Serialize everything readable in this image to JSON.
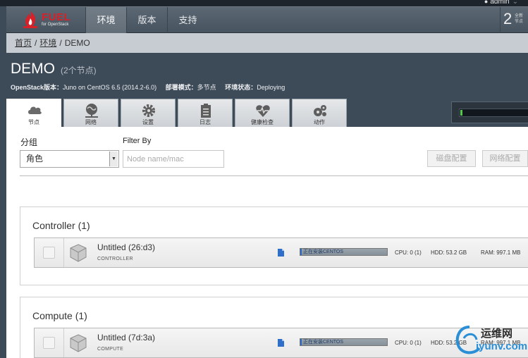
{
  "user": {
    "name": "admin"
  },
  "nav": {
    "logo_word": "FUEL",
    "logo_sub": "for OpenStack",
    "tabs": [
      {
        "label": "环境",
        "active": true
      },
      {
        "label": "版本",
        "active": false
      },
      {
        "label": "支持",
        "active": false
      }
    ],
    "notifications": {
      "count": "2",
      "label_line1": "全新",
      "label_line2": "节点"
    }
  },
  "breadcrumb": {
    "home": "首页",
    "environments": "环境",
    "current": "DEMO",
    "sep": "/"
  },
  "environment": {
    "name": "DEMO",
    "node_count_text": "(2个节点)",
    "openstack_label": "OpenStack版本：",
    "openstack_value": "Juno on CentOS 6.5 (2014.2-6.0)",
    "mode_label": "部署模式：",
    "mode_value": "多节点",
    "status_label": "环境状态：",
    "status_value": "Deploying",
    "deploy_progress": 0.02
  },
  "tabs": [
    {
      "label": "节点",
      "icon": "cloud-icon",
      "active": true
    },
    {
      "label": "网络",
      "icon": "network-icon",
      "active": false
    },
    {
      "label": "设置",
      "icon": "gear-icon",
      "active": false
    },
    {
      "label": "日志",
      "icon": "clipboard-icon",
      "active": false
    },
    {
      "label": "健康检查",
      "icon": "heartbeat-icon",
      "active": false
    },
    {
      "label": "动作",
      "icon": "gears-icon",
      "active": false
    }
  ],
  "toolbar": {
    "group_label": "分组",
    "group_value": "角色",
    "filter_label": "Filter By",
    "filter_placeholder": "Node name/mac",
    "disk_button": "磁盘配置",
    "network_button": "网络配置"
  },
  "groups": [
    {
      "title": "Controller (1)",
      "nodes": [
        {
          "name": "Untitled (26:d3)",
          "role": "CONTROLLER",
          "progress_text": "正在安装CENTOS",
          "progress": 0.02,
          "cpu": "CPU: 0 (1)",
          "hdd": "HDD: 53.2 GB",
          "ram": "RAM: 997.1 MB"
        }
      ]
    },
    {
      "title": "Compute (1)",
      "nodes": [
        {
          "name": "Untitled (7d:3a)",
          "role": "COMPUTE",
          "progress_text": "正在安装CENTOS",
          "progress": 0.02,
          "cpu": "CPU: 0 (1)",
          "hdd": "HDD: 53.2 GB",
          "ram": "RAM: 997.1 MB"
        }
      ]
    }
  ],
  "watermark": {
    "line1": "运维网",
    "line2": "iyunv.com"
  }
}
